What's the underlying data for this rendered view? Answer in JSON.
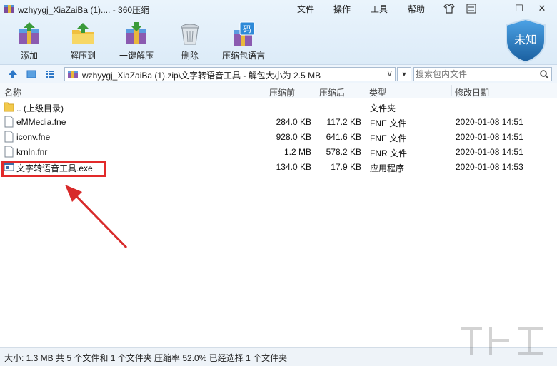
{
  "window": {
    "title": "wzhyygj_XiaZaiBa (1)....  - 360压缩",
    "menu": [
      "文件",
      "操作",
      "工具",
      "帮助"
    ]
  },
  "toolbar": {
    "buttons": [
      {
        "label": "添加",
        "icon": "add-archive-icon"
      },
      {
        "label": "解压到",
        "icon": "extract-to-icon"
      },
      {
        "label": "一键解压",
        "icon": "one-click-extract-icon"
      },
      {
        "label": "删除",
        "icon": "trash-icon"
      },
      {
        "label": "压缩包语言",
        "icon": "encoding-icon",
        "badge": "码"
      }
    ],
    "shield_text": "未知"
  },
  "addressbar": {
    "path": "wzhyygj_XiaZaiBa (1).zip\\文字转语音工具 - 解包大小为 2.5 MB",
    "search_placeholder": "搜索包内文件"
  },
  "list": {
    "columns": [
      "名称",
      "压缩前",
      "压缩后",
      "类型",
      "修改日期"
    ],
    "rows": [
      {
        "name": ".. (上级目录)",
        "before": "",
        "after": "",
        "type": "文件夹",
        "date": "",
        "icon": "folder-icon"
      },
      {
        "name": "eMMedia.fne",
        "before": "284.0 KB",
        "after": "117.2 KB",
        "type": "FNE 文件",
        "date": "2020-01-08 14:51",
        "icon": "file-icon"
      },
      {
        "name": "iconv.fne",
        "before": "928.0 KB",
        "after": "641.6 KB",
        "type": "FNE 文件",
        "date": "2020-01-08 14:51",
        "icon": "file-icon"
      },
      {
        "name": "krnln.fnr",
        "before": "1.2 MB",
        "after": "578.2 KB",
        "type": "FNR 文件",
        "date": "2020-01-08 14:51",
        "icon": "file-icon"
      },
      {
        "name": "文字转语音工具.exe",
        "before": "134.0 KB",
        "after": "17.9 KB",
        "type": "应用程序",
        "date": "2020-01-08 14:53",
        "icon": "exe-icon"
      }
    ]
  },
  "status": {
    "text": "大小: 1.3 MB 共 5 个文件和 1 个文件夹 压缩率 52.0% 已经选择 1 个文件夹"
  },
  "colors": {
    "accent": "#2e78c7",
    "highlight": "#e22a2a",
    "shield": "#1f6fae"
  }
}
